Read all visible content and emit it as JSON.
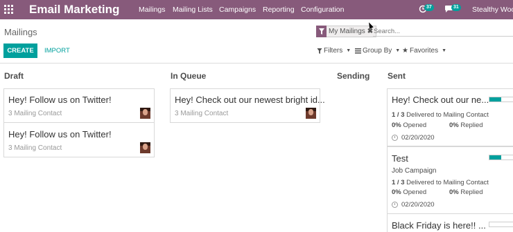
{
  "navbar": {
    "app_name": "Email Marketing",
    "menus": [
      "Mailings",
      "Mailing Lists",
      "Campaigns",
      "Reporting",
      "Configuration"
    ],
    "activity_count": "37",
    "messages_count": "31",
    "user": "Stealthy Wood"
  },
  "control": {
    "title": "Mailings",
    "facet_label": "My Mailings",
    "search_placeholder": "Search...",
    "create_label": "CREATE",
    "import_label": "IMPORT",
    "filters_label": "Filters",
    "groupby_label": "Group By",
    "favorites_label": "Favorites"
  },
  "columns": {
    "draft": {
      "title": "Draft",
      "cards": [
        {
          "title": "Hey! Follow us on Twitter!",
          "subtitle": "3 Mailing Contact"
        },
        {
          "title": "Hey! Follow us on Twitter!",
          "subtitle": "3 Mailing Contact"
        }
      ]
    },
    "in_queue": {
      "title": "In Queue",
      "cards": [
        {
          "title": "Hey! Check out our newest bright id...",
          "subtitle": "3 Mailing Contact"
        }
      ]
    },
    "sending": {
      "title": "Sending"
    },
    "sent": {
      "title": "Sent",
      "cards": [
        {
          "title": "Hey! Check out our ne...",
          "progress": 0.5,
          "delivered": "1 / 3",
          "delivered_text": "Delivered to Mailing Contact",
          "opened_value": "0%",
          "opened_label": "Opened",
          "replied_value": "0%",
          "replied_label": "Replied",
          "date": "02/20/2020"
        },
        {
          "title": "Test",
          "campaign": "Job Campaign",
          "progress": 0.5,
          "delivered": "1 / 3",
          "delivered_text": "Delivered to Mailing Contact",
          "opened_value": "0%",
          "opened_label": "Opened",
          "replied_value": "0%",
          "replied_label": "Replied",
          "date": "02/20/2020"
        },
        {
          "title": "Black Friday is here!! ...",
          "progress": 0
        }
      ]
    }
  },
  "colors": {
    "navbar": "#875a7b",
    "accent": "#00a09d"
  },
  "icons": [
    "apps-grid-icon",
    "activity-clock-icon",
    "chat-icon",
    "filter-funnel-icon",
    "remove-facet-icon",
    "filter-icon",
    "group-by-icon",
    "star-icon",
    "clock-icon"
  ]
}
